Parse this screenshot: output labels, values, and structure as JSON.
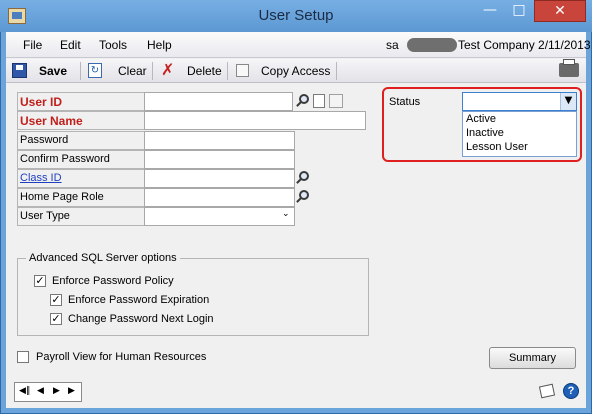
{
  "window": {
    "title": "User Setup"
  },
  "menu": {
    "items": [
      "File",
      "Edit",
      "Tools",
      "Help"
    ]
  },
  "header_right": {
    "user": "sa",
    "company_date": "Test Company  2/11/2013"
  },
  "toolbar": {
    "save": "Save",
    "clear": "Clear",
    "delete": "Delete",
    "copy_access": "Copy Access"
  },
  "form": {
    "user_id": {
      "label": "User ID",
      "value": ""
    },
    "user_name": {
      "label": "User Name",
      "value": ""
    },
    "password": {
      "label": "Password",
      "value": ""
    },
    "confirm_password": {
      "label": "Confirm Password",
      "value": ""
    },
    "class_id": {
      "label": "Class ID",
      "value": ""
    },
    "home_page_role": {
      "label": "Home Page Role",
      "value": ""
    },
    "user_type": {
      "label": "User Type",
      "value": ""
    }
  },
  "sql_options": {
    "title": "Advanced SQL Server options",
    "enforce_policy": {
      "label": "Enforce Password Policy",
      "checked": true
    },
    "enforce_expiration": {
      "label": "Enforce Password Expiration",
      "checked": true
    },
    "change_next_login": {
      "label": "Change Password Next Login",
      "checked": true
    }
  },
  "payroll_view": {
    "label": "Payroll View for Human Resources",
    "checked": false
  },
  "status": {
    "label": "Status",
    "selected": "",
    "options": [
      "Active",
      "Inactive",
      "Lesson User"
    ]
  },
  "summary_button": "Summary",
  "colors": {
    "required_label": "#c0201b",
    "link_label": "#1f3fbf",
    "highlight_border": "#e02020",
    "title_bar": "#6aa4da"
  },
  "icons": [
    "app-icon",
    "save-icon",
    "clear-icon",
    "delete-icon",
    "copy-access-icon",
    "printer-icon",
    "lookup-icon",
    "new-note-icon",
    "expand-icon",
    "note-icon",
    "help-icon"
  ]
}
